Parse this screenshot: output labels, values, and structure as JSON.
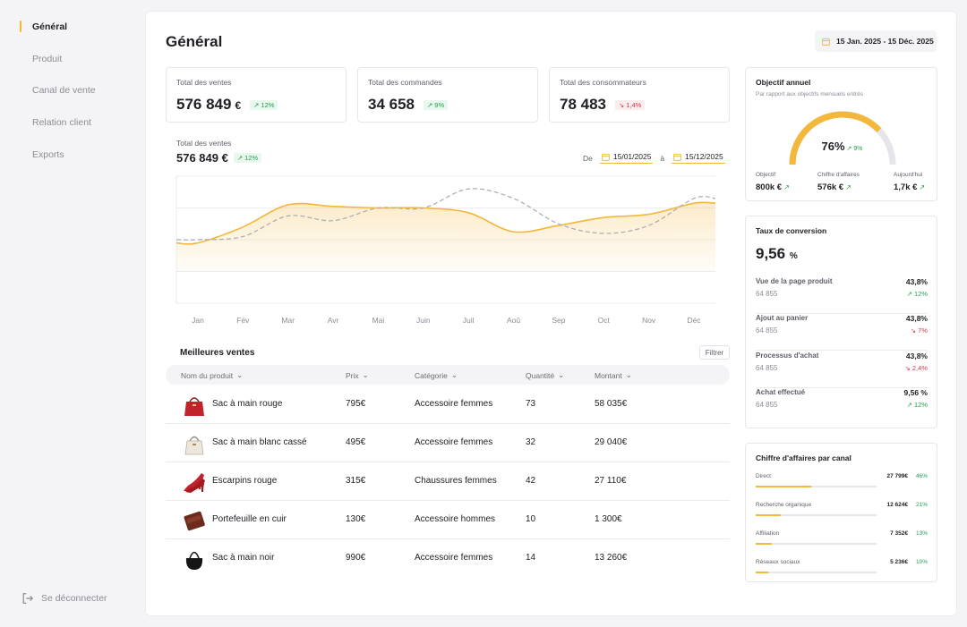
{
  "sidebar": {
    "items": [
      {
        "label": "Général",
        "active": true
      },
      {
        "label": "Produit"
      },
      {
        "label": "Canal de vente"
      },
      {
        "label": "Relation client"
      },
      {
        "label": "Exports"
      }
    ],
    "logout": "Se déconnecter"
  },
  "header": {
    "title": "Général",
    "date_range": "15 Jan. 2025 - 15 Déc. 2025"
  },
  "kpis": [
    {
      "label": "Total des ventes",
      "value": "576 849",
      "unit": "€",
      "delta": "12%",
      "trend": "up"
    },
    {
      "label": "Total des commandes",
      "value": "34 658",
      "unit": "",
      "delta": "9%",
      "trend": "up"
    },
    {
      "label": "Total des consommateurs",
      "value": "78 483",
      "unit": "",
      "delta": "1,4%",
      "trend": "down"
    }
  ],
  "sales_chart": {
    "title": "Total des ventes",
    "value": "576 849 €",
    "delta": "12%",
    "from_label": "De",
    "from_date": "15/01/2025",
    "to_label": "à",
    "to_date": "15/12/2025"
  },
  "chart_data": {
    "type": "area",
    "categories": [
      "Jan",
      "Fév",
      "Mar",
      "Avr",
      "Mai",
      "Juin",
      "Juil",
      "Aoû",
      "Sep",
      "Oct",
      "Nov",
      "Déc"
    ],
    "series": [
      {
        "style": "solid-area",
        "color": "#f3b73c",
        "values": [
          38,
          48,
          62,
          61,
          60,
          60,
          57,
          45,
          49,
          54,
          56,
          63
        ]
      },
      {
        "style": "dashed",
        "color": "#a9a9b0",
        "values": [
          40,
          42,
          55,
          52,
          60,
          60,
          72,
          66,
          50,
          44,
          49,
          66
        ]
      }
    ],
    "ylim": [
      0,
      80
    ],
    "grid": true
  },
  "best_sales": {
    "title": "Meilleures ventes",
    "filter_label": "Filtrer",
    "columns": [
      "Nom du produit",
      "Prix",
      "Catégorie",
      "Quantité",
      "Montant"
    ],
    "rows": [
      {
        "name": "Sac à main rouge",
        "price": "795€",
        "category": "Accessoire femmes",
        "qty": "73",
        "amount": "58 035€",
        "icon": "red-handbag-icon"
      },
      {
        "name": "Sac à main blanc cassé",
        "price": "495€",
        "category": "Accessoire femmes",
        "qty": "32",
        "amount": "29 040€",
        "icon": "white-handbag-icon"
      },
      {
        "name": "Escarpins rouge",
        "price": "315€",
        "category": "Chaussures femmes",
        "qty": "42",
        "amount": "27 110€",
        "icon": "red-heels-icon"
      },
      {
        "name": "Portefeuille en cuir",
        "price": "130€",
        "category": "Accessoire hommes",
        "qty": "10",
        "amount": "1 300€",
        "icon": "leather-wallet-icon"
      },
      {
        "name": "Sac à main noir",
        "price": "990€",
        "category": "Accessoire femmes",
        "qty": "14",
        "amount": "13 260€",
        "icon": "black-handbag-icon"
      }
    ]
  },
  "annual_goal": {
    "title": "Objectif annuel",
    "subtitle": "Par rapport aux objectifs mensuels entrés",
    "percent": "76%",
    "percent_value": 0.76,
    "delta": "9%",
    "stats": [
      {
        "label": "Objectif",
        "value": "800k €"
      },
      {
        "label": "Chiffre d'affaires",
        "value": "576k €"
      },
      {
        "label": "Aujourd'hui",
        "value": "1,7k €"
      }
    ]
  },
  "conversion": {
    "title": "Taux de conversion",
    "value": "9,56",
    "unit": "%",
    "steps": [
      {
        "label": "Vue de la page produit",
        "count": "64 855",
        "pct": "43,8%",
        "delta": "12%",
        "trend": "up"
      },
      {
        "label": "Ajout au panier",
        "count": "64 855",
        "pct": "43,8%",
        "delta": "7%",
        "trend": "down"
      },
      {
        "label": "Processus d'achat",
        "count": "64 855",
        "pct": "43,8%",
        "delta": "2,4%",
        "trend": "down"
      },
      {
        "label": "Achat effectué",
        "count": "64 855",
        "pct": "9,56 %",
        "delta": "12%",
        "trend": "up"
      }
    ]
  },
  "revenue_by_channel": {
    "title": "Chiffre d'affaires par canal",
    "channels": [
      {
        "label": "Direct",
        "amount": "27 799€",
        "pct": "46%",
        "share": 0.46
      },
      {
        "label": "Recherche organique",
        "amount": "12 624€",
        "pct": "21%",
        "share": 0.21
      },
      {
        "label": "Affiliation",
        "amount": "7 352€",
        "pct": "13%",
        "share": 0.13
      },
      {
        "label": "Réseaux sociaux",
        "amount": "5 236€",
        "pct": "10%",
        "share": 0.1
      }
    ]
  },
  "colors": {
    "accent": "#f3b73c",
    "up": "#22a04b",
    "down": "#d9354a"
  }
}
